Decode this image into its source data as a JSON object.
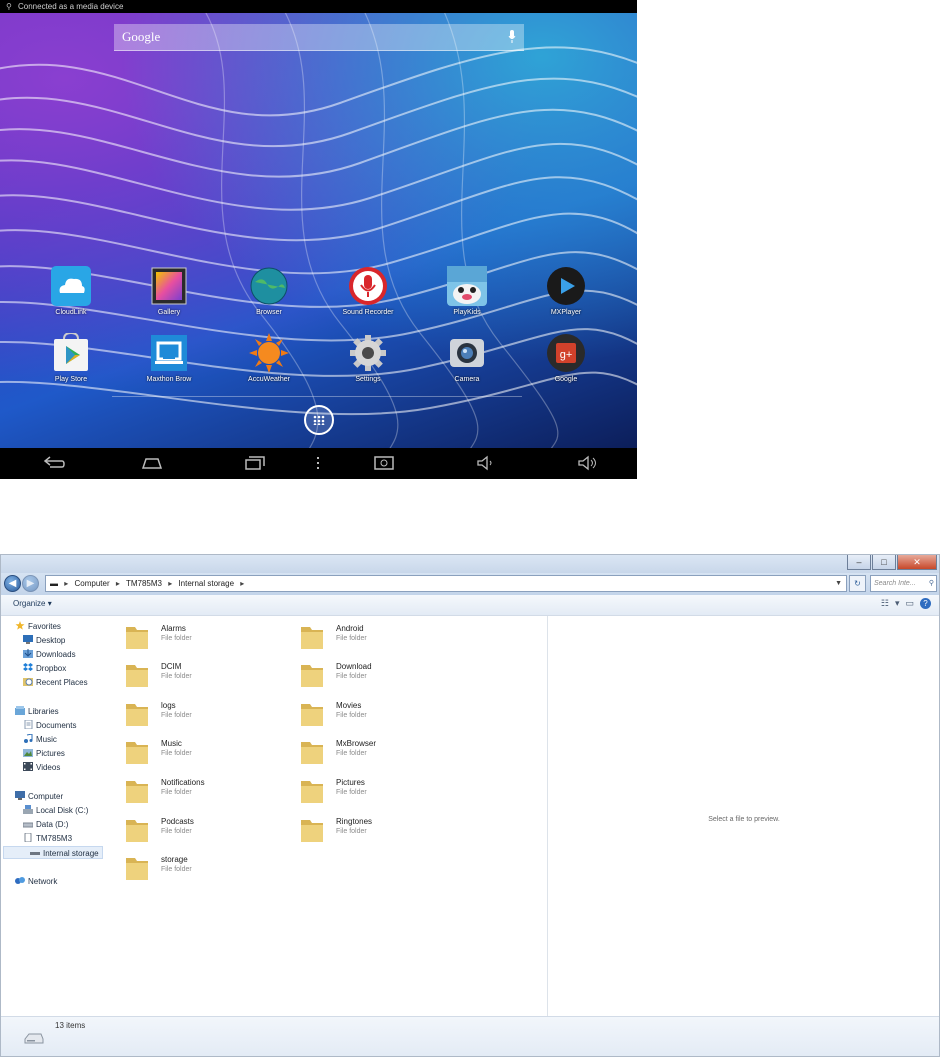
{
  "android": {
    "status_text": "Connected as a media device",
    "status_icon": "usb-icon",
    "search_label": "Google",
    "apps": [
      {
        "label": "CloudLink",
        "icon": "cloud-icon"
      },
      {
        "label": "Gallery",
        "icon": "gallery-icon"
      },
      {
        "label": "Browser",
        "icon": "globe-icon"
      },
      {
        "label": "Sound Recorder",
        "icon": "microphone-icon"
      },
      {
        "label": "PlayKids",
        "icon": "playkids-icon"
      },
      {
        "label": "MXPlayer",
        "icon": "play-icon"
      },
      {
        "label": "Play Store",
        "icon": "play-store-icon"
      },
      {
        "label": "Maxthon Brow",
        "icon": "maxthon-icon"
      },
      {
        "label": "AccuWeather",
        "icon": "sun-icon"
      },
      {
        "label": "Settings",
        "icon": "gear-icon"
      },
      {
        "label": "Camera",
        "icon": "camera-icon"
      },
      {
        "label": "Google",
        "icon": "google-plus-icon"
      }
    ],
    "nav_icons": [
      "back-icon",
      "home-icon",
      "recents-icon",
      "menu-icon",
      "screenshot-icon",
      "volume-down-icon",
      "volume-up-icon"
    ]
  },
  "explorer": {
    "breadcrumb": [
      "Computer",
      "TM785M3",
      "Internal storage"
    ],
    "search_placeholder": "Search Inte...",
    "organize_label": "Organize",
    "nav": {
      "favorites": {
        "label": "Favorites",
        "items": [
          "Desktop",
          "Downloads",
          "Dropbox",
          "Recent Places"
        ]
      },
      "libraries": {
        "label": "Libraries",
        "items": [
          "Documents",
          "Music",
          "Pictures",
          "Videos"
        ]
      },
      "computer": {
        "label": "Computer",
        "items": [
          "Local Disk (C:)",
          "Data (D:)",
          "TM785M3",
          "Internal storage"
        ]
      },
      "network": {
        "label": "Network"
      }
    },
    "folder_type": "File folder",
    "folders_left": [
      "Alarms",
      "DCIM",
      "logs",
      "Music",
      "Notifications",
      "Podcasts",
      "storage"
    ],
    "folders_right": [
      "Android",
      "Download",
      "Movies",
      "MxBrowser",
      "Pictures",
      "Ringtones"
    ],
    "preview_text": "Select a file to preview.",
    "status_count": "13 items"
  },
  "colors": {
    "accent": "#2f6cc0",
    "folder": "#e8c76a",
    "navbar": "#000000"
  }
}
